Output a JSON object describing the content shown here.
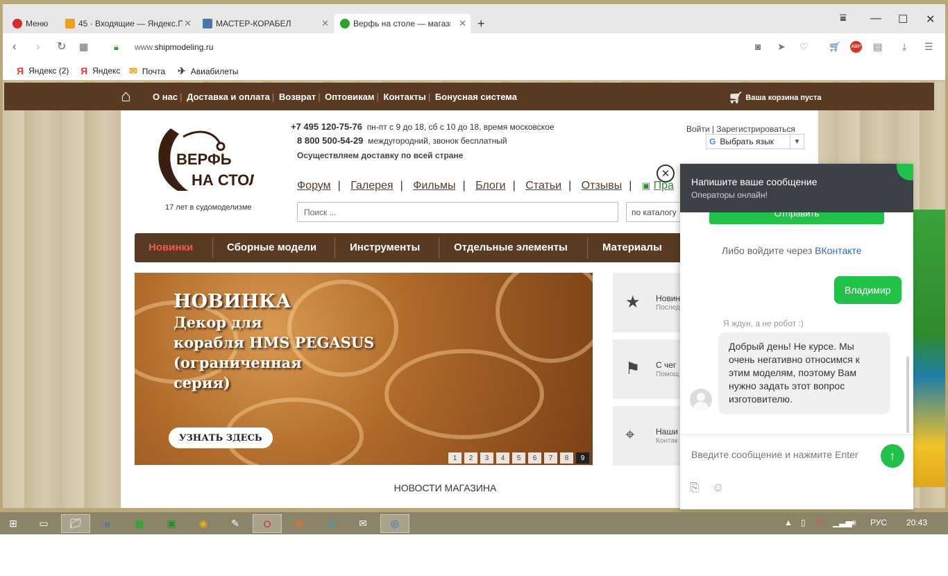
{
  "browser": {
    "tabs": [
      {
        "label": "Меню",
        "closable": false
      },
      {
        "label": "45 · Входящие — Яндекс.П",
        "closable": true
      },
      {
        "label": "МАСТЕР-КОРАБЕЛ",
        "closable": true
      },
      {
        "label": "Верфь на столе — магазин",
        "closable": true
      }
    ],
    "new_tab": "+",
    "url_prefix": "www.",
    "url_domain": "shipmodeling.ru",
    "bookmarks": [
      {
        "label": "Яндекс (2)",
        "icon": "yandex-icon"
      },
      {
        "label": "Яндекс",
        "icon": "yandex-icon"
      },
      {
        "label": "Почта",
        "icon": "mail-icon"
      },
      {
        "label": "Авиабилеты",
        "icon": "plane-icon"
      }
    ]
  },
  "site": {
    "topnav": [
      "О нас",
      "Доставка и оплата",
      "Возврат",
      "Оптовикам",
      "Контакты",
      "Бонусная система"
    ],
    "cart": "Ваша корзина пуста",
    "logo_line1": "ВЕРФЬ",
    "logo_line2": "НА СТОЛЕ",
    "logo_sub": "17 лет в судомоделизме",
    "phone1": "+7 495 120-75-76",
    "phone1_note": "пн-пт с 9 до 18, сб с 10 до 18, время московское",
    "phone2": "8 800 500-54-29",
    "phone2_note": "междугородний, звонок бесплатный",
    "delivery": "Осуществляем доставку по всей стране",
    "login": "Войти",
    "register": "Зарегистрироваться",
    "translate": "Выбрать язык",
    "subnav": [
      "Форум",
      "Галерея",
      "Фильмы",
      "Блоги",
      "Статьи",
      "Отзывы",
      "Пра"
    ],
    "search_placeholder": "Поиск ...",
    "catalog_select": "по каталогу",
    "mainnav": [
      "Новинки",
      "Сборные модели",
      "Инструменты",
      "Отдельные элементы",
      "Материалы"
    ],
    "banner": {
      "title": "НОВИНКА",
      "line1": "Декор для",
      "line2": "корабля HMS PEGASUS",
      "line3": "(ограниченная",
      "line4": "серия)",
      "button": "УЗНАТЬ ЗДЕСЬ",
      "pages": [
        "1",
        "2",
        "3",
        "4",
        "5",
        "6",
        "7",
        "8",
        "9"
      ],
      "active_page": "9"
    },
    "side_cards": [
      {
        "title": "Новин",
        "sub": "Послед",
        "icon": "star-icon"
      },
      {
        "title": "С чег",
        "sub": "Помощ",
        "icon": "flag-icon"
      },
      {
        "title": "Наши",
        "sub": "Контак",
        "icon": "location-icon"
      }
    ],
    "news_heading": "НОВОСТИ МАГАЗИНА"
  },
  "chat": {
    "title": "Напишите ваше сообщение",
    "subtitle": "Операторы онлайн!",
    "send_button": "Отправить",
    "vk_prefix": "Либо войдите через ",
    "vk_link": "ВКонтакте",
    "my_message": "Владимир",
    "note": "Я ждун, а не робот :)",
    "operator_message": "Добрый день! Не курсе. Мы очень негативно относимся к этим моделям, поэтому Вам нужно задать этот вопрос изготовителю.",
    "input_placeholder": "Введите сообщение и нажмите Enter"
  },
  "taskbar": {
    "lang": "РУС",
    "time": "20:43"
  },
  "colors": {
    "brand_brown": "#5a3a22",
    "chat_green": "#22c14a",
    "chat_header": "#3c4147",
    "accent_red": "#e53935"
  }
}
